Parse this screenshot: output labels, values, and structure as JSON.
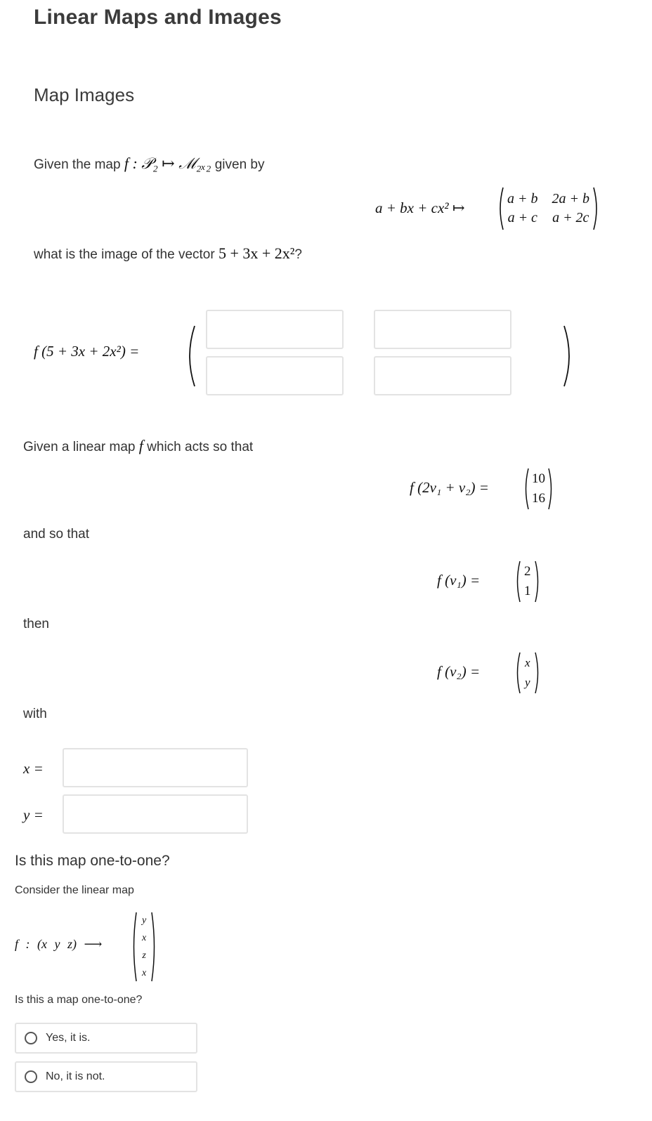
{
  "page": {
    "title": "Linear Maps and Images",
    "section": "Map Images"
  },
  "q1": {
    "intro_prefix": "Given the map",
    "intro_math": "f : 𝒫₂ ↦ ℳ₂ₓ₂",
    "intro_suffix": "given by",
    "map_lhs": "a + bx + cx² ↦",
    "matrix": [
      [
        "a + b",
        "2a + b"
      ],
      [
        "a + c",
        "a + 2c"
      ]
    ],
    "question_prefix": "what is the image of the vector",
    "question_math": "5 + 3x + 2x²",
    "question_suffix": "?",
    "answer_lhs": "f (5 + 3x + 2x²) =",
    "answer_inputs": [
      {
        "name": "entry-1-1",
        "value": ""
      },
      {
        "name": "entry-1-2",
        "value": ""
      },
      {
        "name": "entry-2-1",
        "value": ""
      },
      {
        "name": "entry-2-2",
        "value": ""
      }
    ]
  },
  "q2": {
    "intro_prefix": "Given a linear map",
    "intro_math": "f",
    "intro_suffix": "which acts so that",
    "eq1_lhs": "f (2v₁ + v₂) =",
    "eq1_vector": [
      "10",
      "16"
    ],
    "and_text": "and so that",
    "eq2_lhs": "f (v₁) =",
    "eq2_vector": [
      "2",
      "1"
    ],
    "then_text": "then",
    "eq3_lhs": "f (v₂) =",
    "eq3_vector": [
      "x",
      "y"
    ],
    "with_text": "with",
    "x_label": "x =",
    "y_label": "y =",
    "x_value": "",
    "y_value": ""
  },
  "q3": {
    "title": "Is this map one-to-one?",
    "intro": "Consider the linear map",
    "map_lhs": "f : (x  y  z) ⟶",
    "map_vector": [
      "y",
      "x",
      "z",
      "x"
    ],
    "question": "Is this a map one-to-one?",
    "options": [
      {
        "label": "Yes, it is.",
        "selected": false
      },
      {
        "label": "No, it is not.",
        "selected": false
      }
    ]
  }
}
